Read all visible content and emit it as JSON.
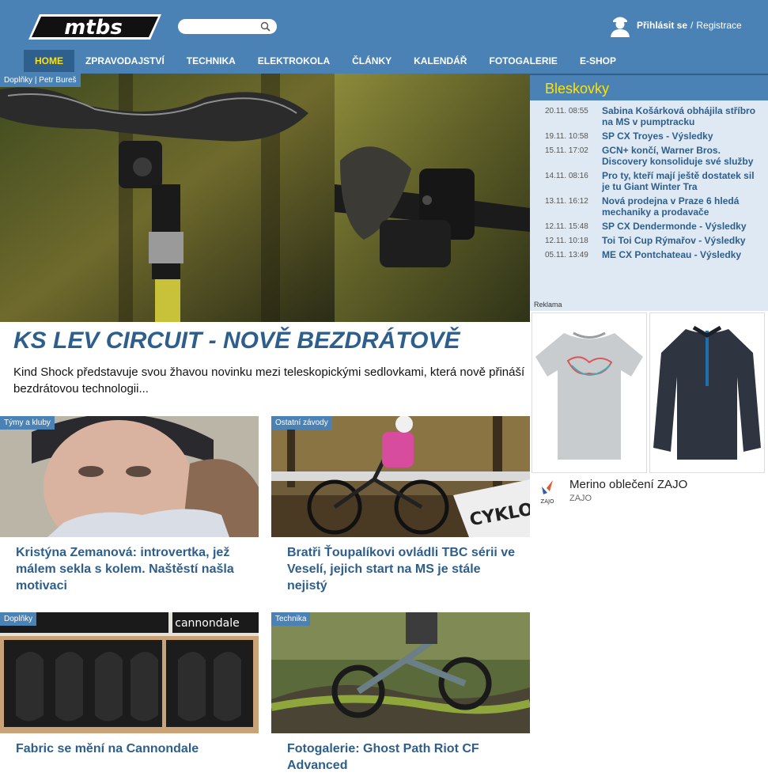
{
  "header": {
    "logo_text": "mtbs",
    "search": {
      "placeholder": "",
      "value": ""
    },
    "login_label": "Přihlásit se",
    "separator": "/",
    "register_label": "Registrace"
  },
  "nav": {
    "items": [
      {
        "label": "HOME",
        "active": true
      },
      {
        "label": "ZPRAVODAJSTVÍ"
      },
      {
        "label": "TECHNIKA"
      },
      {
        "label": "ELEKTROKOLA"
      },
      {
        "label": "ČLÁNKY"
      },
      {
        "label": "KALENDÁŘ"
      },
      {
        "label": "FOTOGALERIE"
      },
      {
        "label": "E-SHOP"
      }
    ]
  },
  "hero": {
    "tag": "Doplňky | Petr Bureš",
    "title": "KS LEV CIRCUIT - NOVĚ BEZDRÁTOVĚ",
    "description": "Kind Shock představuje svou žhavou novinku mezi teleskopickými sedlovkami, která nově přináší bezdrátovou technologii..."
  },
  "cards": [
    {
      "tag": "Týmy a kluby",
      "title": "Kristýna Zemanová: introvertka, jež málem sekla s kolem. Naštěstí našla motivaci"
    },
    {
      "tag": "Ostatní závody",
      "title": "Bratři Ťoupalíkovi ovládli TBC sérii ve Veselí, jejich start na MS je stále nejistý",
      "banner_text": "CYKLOS"
    },
    {
      "tag": "Doplňky",
      "title": "Fabric se mění na Cannondale",
      "brand_text": "cannondale"
    },
    {
      "tag": "Technika",
      "title": "Fotogalerie: Ghost Path Riot CF Advanced"
    }
  ],
  "sidebar": {
    "title": "Bleskovky",
    "items": [
      {
        "date": "20.11. 08:55",
        "text": "Sabina Košárková obhájila stříbro na MS v pumptracku"
      },
      {
        "date": "19.11. 10:58",
        "text": "SP CX Troyes - Výsledky"
      },
      {
        "date": "15.11. 17:02",
        "text": "GCN+ končí, Warner Bros. Discovery konsoliduje své služby"
      },
      {
        "date": "14.11. 08:16",
        "text": "Pro ty, kteří mají ještě dostatek sil je tu Giant Winter Tra"
      },
      {
        "date": "13.11. 16:12",
        "text": "Nová prodejna v Praze 6 hledá mechaniky a prodavače"
      },
      {
        "date": "12.11. 15:48",
        "text": "SP CX Dendermonde - Výsledky"
      },
      {
        "date": "12.11. 10:18",
        "text": "Toi Toi Cup Rýmařov - Výsledky"
      },
      {
        "date": "05.11. 13:49",
        "text": "ME CX Pontchateau - Výsledky"
      }
    ]
  },
  "ad": {
    "label": "Reklama",
    "title": "Merino oblečení ZAJO",
    "brand": "ZAJO"
  },
  "colors": {
    "header_blue": "#4b82b6",
    "nav_active": "#2f5f8d",
    "accent_yellow": "#ffe200",
    "link_blue": "#2e5e8c",
    "sidebar_bg": "#dfe9f3"
  }
}
